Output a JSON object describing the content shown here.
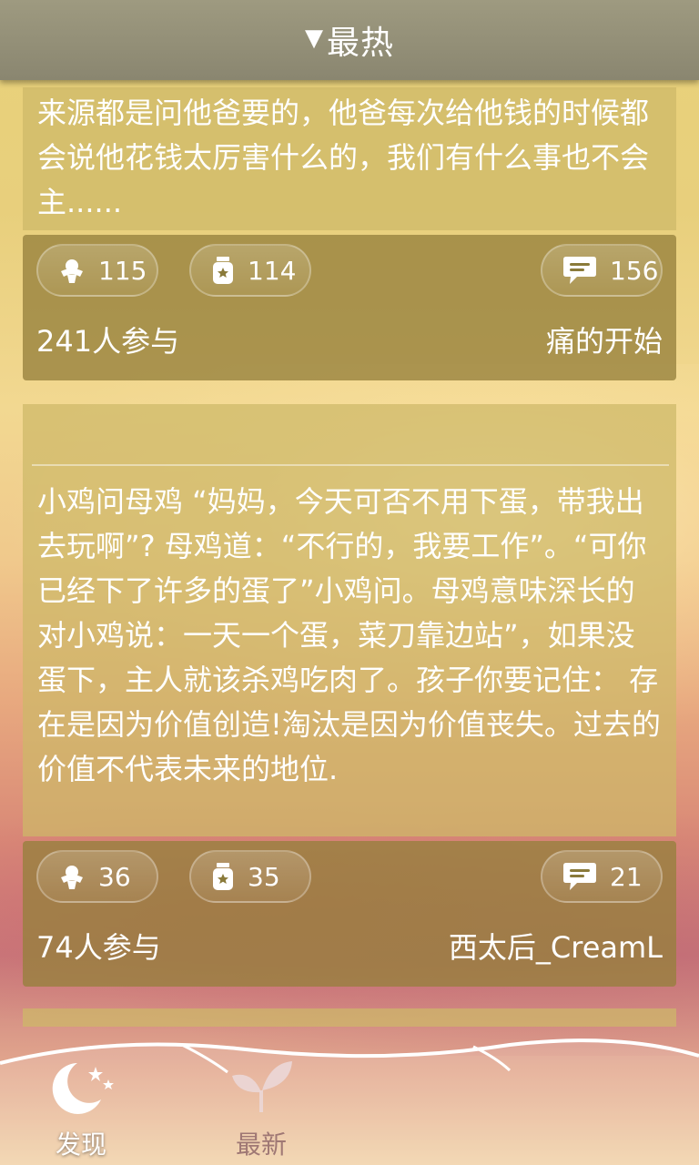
{
  "header": {
    "title": "最热"
  },
  "posts": [
    {
      "text": "来源都是问他爸要的，他爸每次给他钱的时候都会说他花钱太厉害什么的，我们有什么事也不会主......",
      "likes": "115",
      "jars": "114",
      "comments": "156",
      "participants": "241人参与",
      "author": "痛的开始"
    },
    {
      "text": "小鸡问母鸡 “妈妈，今天可否不用下蛋，带我出去玩啊”? 母鸡道：“不行的，我要工作”。“可你已经下了许多的蛋了”小鸡问。母鸡意味深长的对小鸡说：一天一个蛋，菜刀靠边站”，如果没蛋下，主人就该杀鸡吃肉了。孩子你要记住： 存在是因为价值创造!淘汰是因为价值丧失。过去的价值不代表未来的地位.",
      "likes": "36",
      "jars": "35",
      "comments": "21",
      "participants": "74人参与",
      "author": "西太后_CreamL"
    }
  ],
  "tabs": [
    {
      "label": "发现",
      "icon": "moon-stars-icon",
      "active": true
    },
    {
      "label": "最新",
      "icon": "leaf-icon",
      "active": false
    }
  ]
}
